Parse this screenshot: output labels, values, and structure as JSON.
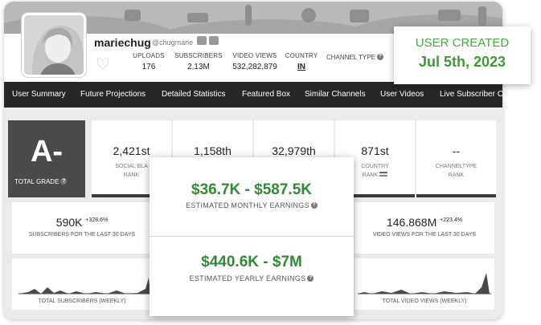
{
  "channel": {
    "name": "mariechug",
    "handle": "@chugmarie"
  },
  "stats": {
    "uploads": {
      "label": "UPLOADS",
      "value": "176"
    },
    "subscribers": {
      "label": "SUBSCRIBERS",
      "value": "2.13M"
    },
    "video_views": {
      "label": "VIDEO VIEWS",
      "value": "532,282,879"
    },
    "country": {
      "label": "COUNTRY",
      "value": "IN"
    },
    "channel_type": {
      "label": "CHANNEL TYPE"
    }
  },
  "nav": [
    "User Summary",
    "Future Projections",
    "Detailed Statistics",
    "Featured Box",
    "Similar Channels",
    "User Videos",
    "Live Subscriber C"
  ],
  "grade": {
    "value": "A-",
    "label": "TOTAL GRADE"
  },
  "ranks": [
    {
      "value": "2,421st",
      "label1": "SOCIAL BLA",
      "label2": "RANK"
    },
    {
      "value": "1,158th",
      "label1": "",
      "label2": ""
    },
    {
      "value": "32,979th",
      "label1": "",
      "label2": ""
    },
    {
      "value": "871st",
      "label1": "COUNTRY",
      "label2": "RANK"
    },
    {
      "value": "--",
      "label1": "CHANNELTYPE",
      "label2": "RANK"
    }
  ],
  "subs30": {
    "value": "590K",
    "change": "+328.6%",
    "label": "SUBSCRIBERS FOR THE LAST 30 DAYS"
  },
  "views30": {
    "value": "146.868M",
    "change": "+223.4%",
    "label": "VIDEO VIEWS FOR THE LAST 30 DAYS"
  },
  "graphs": {
    "subs_label": "TOTAL SUBSCRIBERS (WEEKLY)",
    "views_label": "TOTAL VIDEO VIEWS (WEEKLY)"
  },
  "earnings": {
    "monthly": {
      "range": "$36.7K  -  $587.5K",
      "label": "ESTIMATED MONTHLY EARNINGS"
    },
    "yearly": {
      "range": "$440.6K  -  $7M",
      "label": "ESTIMATED YEARLY EARNINGS"
    }
  },
  "created": {
    "label": "USER CREATED",
    "date": "Jul 5th, 2023"
  },
  "colors": {
    "accent_green": "#3c9a33",
    "nav_bg": "#262626"
  }
}
